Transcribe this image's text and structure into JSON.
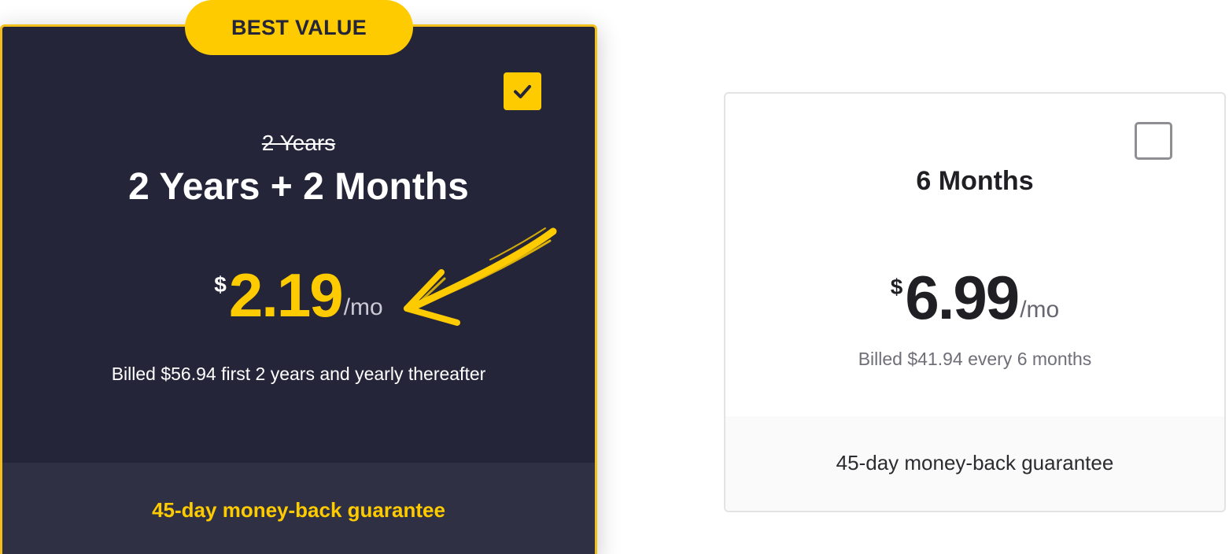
{
  "featured_plan": {
    "badge": "BEST VALUE",
    "original_term": "2 Years",
    "term": "2 Years + 2 Months",
    "price": {
      "currency": "$",
      "amount": "2.19",
      "period": "/mo"
    },
    "billing_note": "Billed $56.94 first 2 years and yearly thereafter",
    "guarantee": "45-day money-back guarantee",
    "selected": true,
    "checkbox_icon": "check-icon",
    "accent_color": "#fecb00",
    "background_color": "#242539"
  },
  "standard_plan": {
    "term": "6 Months",
    "price": {
      "currency": "$",
      "amount": "6.99",
      "period": "/mo"
    },
    "billing_note": "Billed $41.94 every 6 months",
    "guarantee": "45-day money-back guarantee",
    "selected": false
  }
}
